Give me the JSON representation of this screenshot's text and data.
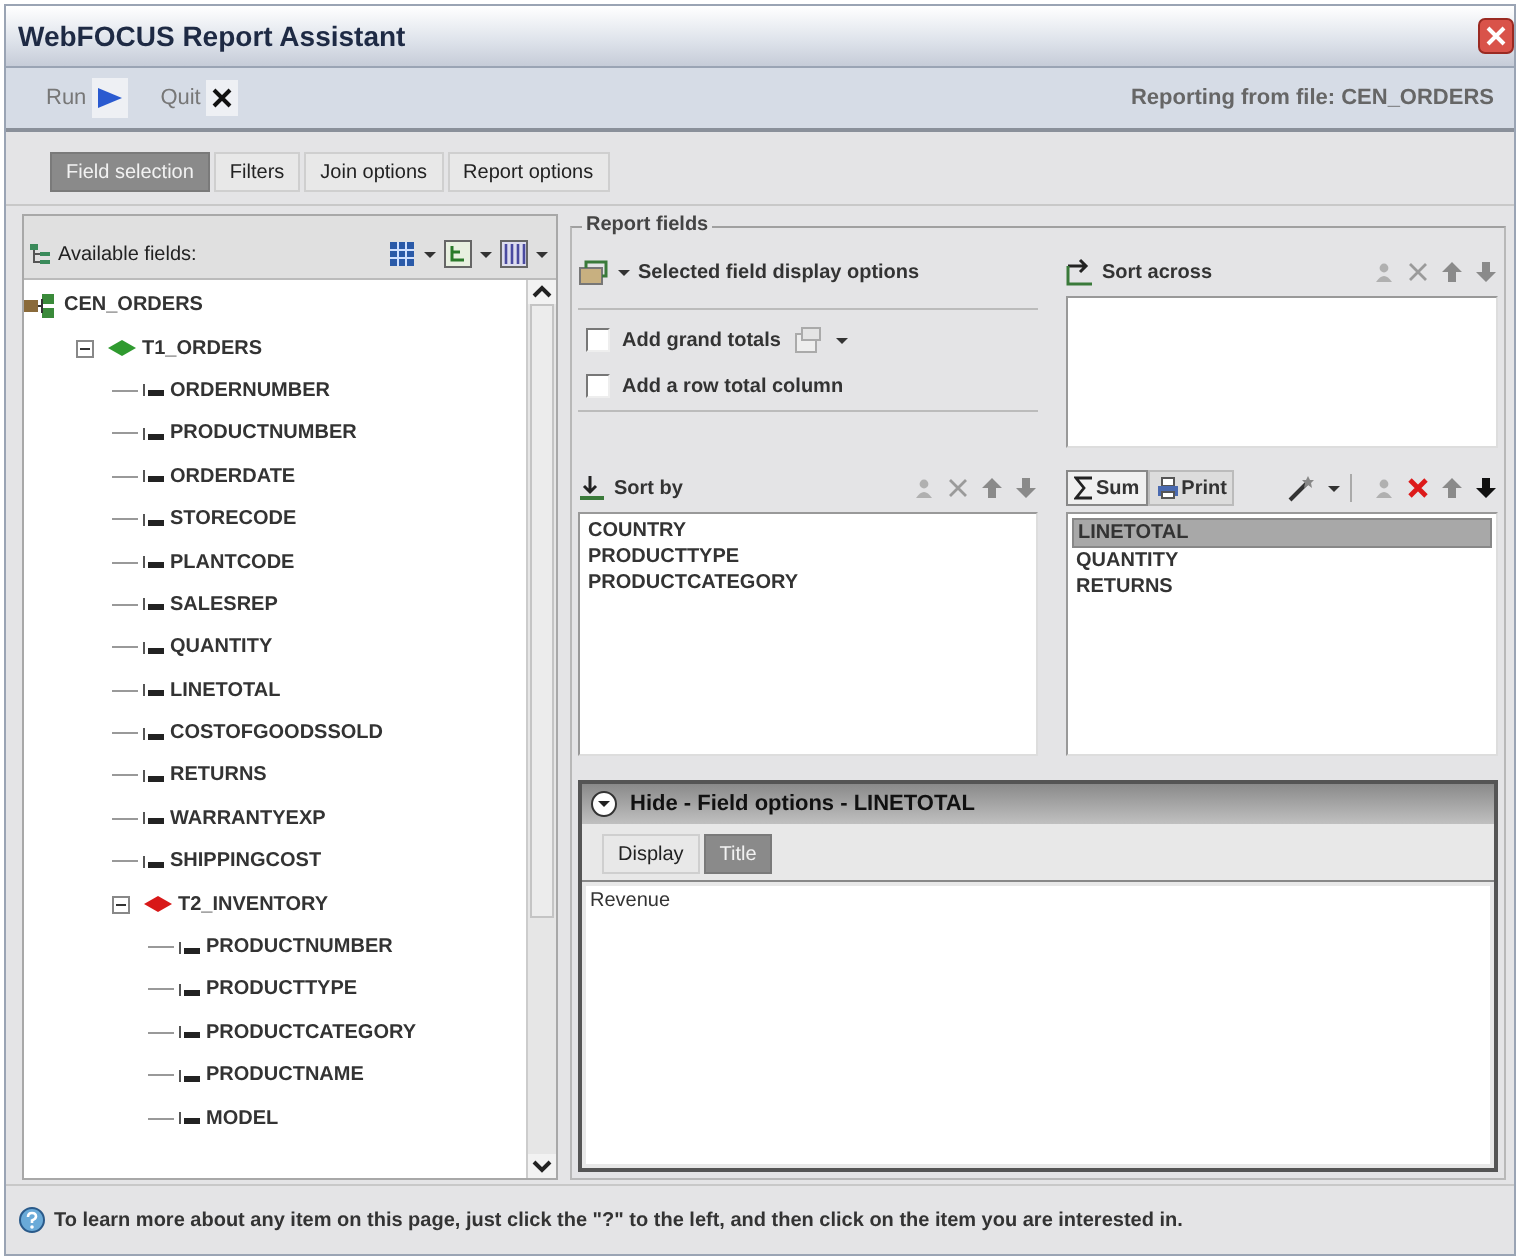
{
  "window": {
    "title": "WebFOCUS Report Assistant"
  },
  "toolbar": {
    "buttons": [
      {
        "label": "Run",
        "kind": "run"
      },
      {
        "label": "Quit",
        "kind": "quit"
      }
    ],
    "source": "Reporting from file: CEN_ORDERS"
  },
  "tabs": [
    {
      "label": "Field selection",
      "selected": true
    },
    {
      "label": "Filters",
      "selected": false
    },
    {
      "label": "Join options",
      "selected": false
    },
    {
      "label": "Report options",
      "selected": false
    }
  ],
  "available_fields": {
    "label": "Available fields:",
    "tree": [
      {
        "label": "CEN_ORDERS",
        "kind": "file",
        "children": [
          {
            "label": "T1_ORDERS",
            "kind": "segment",
            "color": "#2f9a2f",
            "expanded": true,
            "children": [
              {
                "label": "ORDERNUMBER",
                "kind": "field"
              },
              {
                "label": "PRODUCTNUMBER",
                "kind": "field"
              },
              {
                "label": "ORDERDATE",
                "kind": "field"
              },
              {
                "label": "STORECODE",
                "kind": "field"
              },
              {
                "label": "PLANTCODE",
                "kind": "field"
              },
              {
                "label": "SALESREP",
                "kind": "field"
              },
              {
                "label": "QUANTITY",
                "kind": "field"
              },
              {
                "label": "LINETOTAL",
                "kind": "field"
              },
              {
                "label": "COSTOFGOODSSOLD",
                "kind": "field"
              },
              {
                "label": "RETURNS",
                "kind": "field"
              },
              {
                "label": "WARRANTYEXP",
                "kind": "field"
              },
              {
                "label": "SHIPPINGCOST",
                "kind": "field"
              },
              {
                "label": "T2_INVENTORY",
                "kind": "segment",
                "color": "#d81818",
                "expanded": true,
                "children": [
                  {
                    "label": "PRODUCTNUMBER",
                    "kind": "field"
                  },
                  {
                    "label": "PRODUCTTYPE",
                    "kind": "field"
                  },
                  {
                    "label": "PRODUCTCATEGORY",
                    "kind": "field"
                  },
                  {
                    "label": "PRODUCTNAME",
                    "kind": "field"
                  },
                  {
                    "label": "MODEL",
                    "kind": "field"
                  }
                ]
              }
            ]
          }
        ]
      }
    ]
  },
  "report_fields": {
    "legend": "Report fields",
    "display_options": "Selected field display options",
    "options": [
      {
        "label": "Add grand totals",
        "checked": false,
        "kind": "menu"
      },
      {
        "label": "Add a row total column",
        "checked": false,
        "kind": "plain"
      }
    ],
    "sort_across": {
      "label": "Sort across"
    },
    "sort_by": {
      "label": "Sort by",
      "items": [
        "COUNTRY",
        "PRODUCTTYPE",
        "PRODUCTCATEGORY"
      ]
    },
    "measures": {
      "buttons": [
        {
          "label": "Sum",
          "kind": "sum",
          "selected": true
        },
        {
          "label": "Print",
          "kind": "print",
          "selected": false
        }
      ],
      "items": [
        {
          "label": "LINETOTAL",
          "selected": true
        },
        {
          "label": "QUANTITY",
          "selected": false
        },
        {
          "label": "RETURNS",
          "selected": false
        }
      ]
    }
  },
  "field_options": {
    "title": "Hide - Field options - LINETOTAL",
    "tabs": [
      {
        "label": "Display",
        "selected": false
      },
      {
        "label": "Title",
        "selected": true
      }
    ],
    "value": "Revenue"
  },
  "help": "To learn more about any item on this page, just click the \"?\" to the left, and then click on the item you are interested in."
}
